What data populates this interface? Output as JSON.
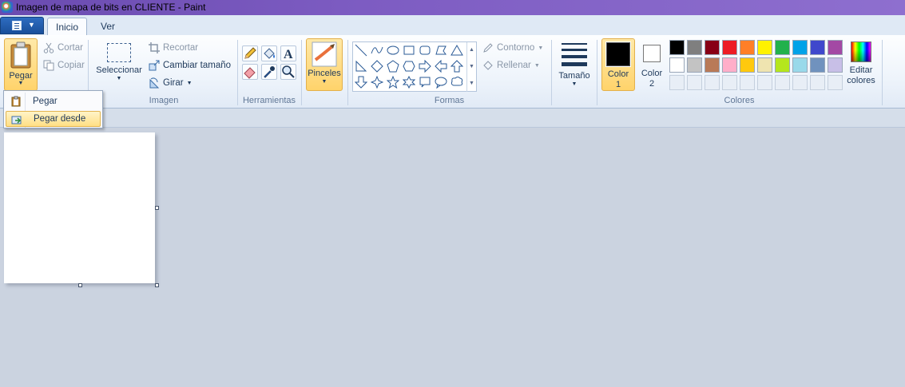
{
  "window": {
    "title": "Imagen de mapa de bits en CLIENTE - Paint"
  },
  "tabs": [
    {
      "label": "Inicio",
      "active": true
    },
    {
      "label": "Ver",
      "active": false
    }
  ],
  "clipboard": {
    "paste_label": "Pegar",
    "cut_label": "Cortar",
    "copy_label": "Copiar"
  },
  "image_group": {
    "label": "Imagen",
    "select_label": "Seleccionar",
    "crop_label": "Recortar",
    "resize_label": "Cambiar tamaño",
    "rotate_label": "Girar"
  },
  "tools_group": {
    "label": "Herramientas",
    "tools": [
      "pencil-icon",
      "fill-icon",
      "text-icon",
      "eraser-icon",
      "color-picker-icon",
      "magnifier-icon"
    ]
  },
  "brushes": {
    "label": "Pinceles"
  },
  "shapes_group": {
    "label": "Formas",
    "outline_label": "Contorno",
    "fill_label": "Rellenar"
  },
  "size": {
    "label": "Tamaño"
  },
  "color1": {
    "label_line1": "Color",
    "label_line2": "1",
    "value": "#000000"
  },
  "color2": {
    "label_line1": "Color",
    "label_line2": "2",
    "value": "#ffffff"
  },
  "colors_group": {
    "label": "Colores",
    "edit_line1": "Editar",
    "edit_line2": "colores",
    "row1": [
      "#000000",
      "#7f7f7f",
      "#880015",
      "#ed1c24",
      "#ff7f27",
      "#fff200",
      "#22b14c",
      "#00a2e8",
      "#3f48cc",
      "#a349a4"
    ],
    "row2": [
      "#ffffff",
      "#c3c3c3",
      "#b97a57",
      "#ffaec9",
      "#ffc90e",
      "#efe4b0",
      "#b5e61d",
      "#99d9ea",
      "#7092be",
      "#c8bfe7"
    ]
  },
  "paste_menu": {
    "items": [
      {
        "label": "Pegar",
        "selected": false
      },
      {
        "label": "Pegar desde",
        "selected": true
      }
    ]
  }
}
